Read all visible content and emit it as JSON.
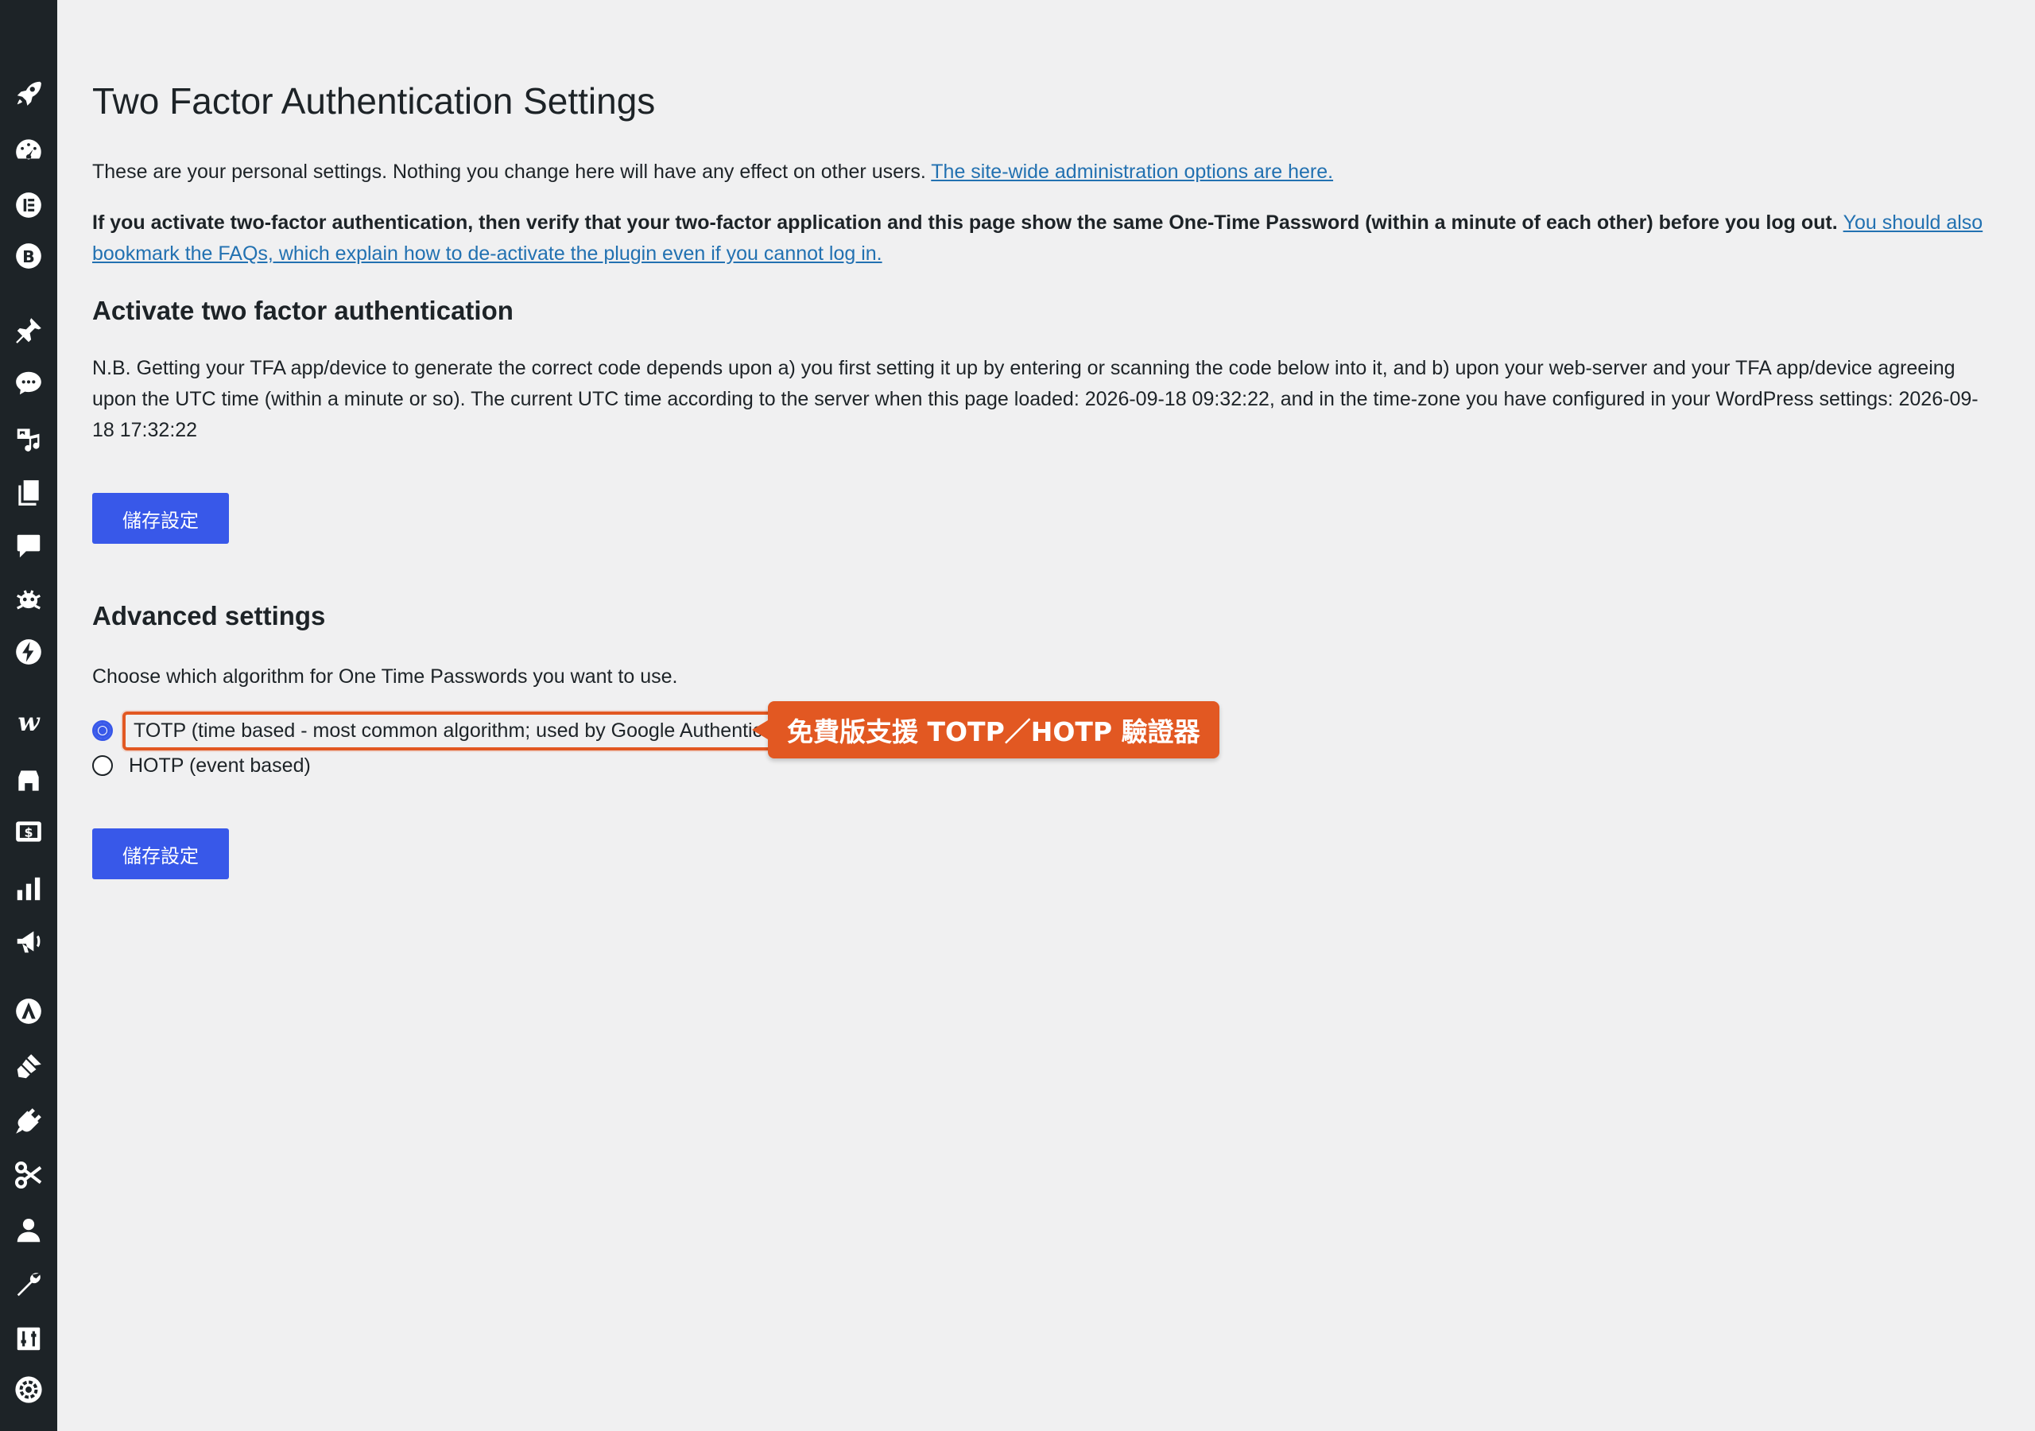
{
  "sidebar": {
    "icons": [
      {
        "name": "rocket-icon"
      },
      {
        "name": "dashboard-icon"
      },
      {
        "name": "elementor-icon"
      },
      {
        "name": "b-logo-icon"
      },
      {
        "name": "pin-icon"
      },
      {
        "name": "comment-bubble-icon"
      },
      {
        "name": "media-icon"
      },
      {
        "name": "pages-icon"
      },
      {
        "name": "comments-icon"
      },
      {
        "name": "bug-icon"
      },
      {
        "name": "lightning-icon"
      },
      {
        "name": "woocommerce-icon"
      },
      {
        "name": "store-icon"
      },
      {
        "name": "payments-icon"
      },
      {
        "name": "analytics-icon"
      },
      {
        "name": "marketing-icon"
      },
      {
        "name": "astra-icon"
      },
      {
        "name": "appearance-icon"
      },
      {
        "name": "plugins-icon"
      },
      {
        "name": "snippets-icon"
      },
      {
        "name": "users-icon"
      },
      {
        "name": "tools-icon"
      },
      {
        "name": "settings-icon"
      },
      {
        "name": "gear-badge-icon"
      }
    ]
  },
  "page": {
    "title": "Two Factor Authentication Settings",
    "intro_text": "These are your personal settings. Nothing you change here will have any effect on other users. ",
    "intro_link": "The site-wide administration options are here.",
    "warning_bold": "If you activate two-factor authentication, then verify that your two-factor application and this page show the same One-Time Password (within a minute of each other) before you log out. ",
    "warning_link": "You should also bookmark the FAQs, which explain how to de-activate the plugin even if you cannot log in.",
    "activate_heading": "Activate two factor authentication",
    "nb_text": "N.B. Getting your TFA app/device to generate the correct code depends upon a) you first setting it up by entering or scanning the code below into it, and b) upon your web-server and your TFA app/device agreeing upon the UTC time (within a minute or so). The current UTC time according to the server when this page loaded: 2026-09-18 09:32:22, and in the time-zone you have configured in your WordPress settings: 2026-09-18 17:32:22",
    "save_label_1": "儲存設定",
    "advanced_heading": "Advanced settings",
    "algorithm_prompt": "Choose which algorithm for One Time Passwords you want to use.",
    "option_totp": "TOTP (time based - most common algorithm; used by Google Authenticator)",
    "option_hotp": "HOTP (event based)",
    "selected_option": "TOTP",
    "save_label_2": "儲存設定"
  },
  "annotation": {
    "callout_text": "免費版支援 TOTP／HOTP 驗證器"
  },
  "colors": {
    "sidebar_bg": "#1d2327",
    "page_bg": "#f0f0f1",
    "button_bg": "#3858e9",
    "link": "#2271b1",
    "callout_bg": "#e25822"
  }
}
